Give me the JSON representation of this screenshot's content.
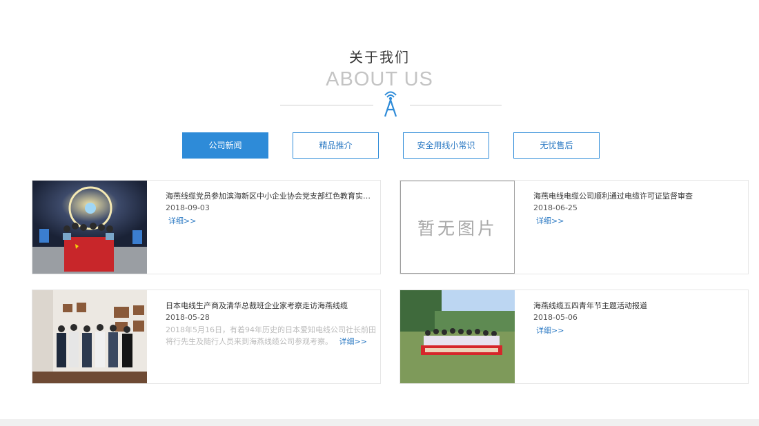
{
  "section": {
    "title_cn": "关于我们",
    "title_en": "ABOUT US",
    "divider_icon": "antenna-tower-icon"
  },
  "tabs": [
    {
      "label": "公司新闻",
      "active": true
    },
    {
      "label": "精品推介",
      "active": false
    },
    {
      "label": "安全用线小常识",
      "active": false
    },
    {
      "label": "无忧售后",
      "active": false
    }
  ],
  "news": [
    {
      "title": "海燕线缆党员参加滨海新区中小企业协会党支部红色教育实践活...",
      "date": "2018-09-03",
      "excerpt": "",
      "more": "详细>>",
      "image": "photo-party-members-with-flag"
    },
    {
      "title": "海燕电线电缆公司顺利通过电缆许可证监督审查",
      "date": "2018-06-25",
      "excerpt": "",
      "more": "详细>>",
      "image": "no-image-placeholder",
      "placeholder_text": "暂无图片"
    },
    {
      "title": "日本电线生产商及清华总裁班企业家考察走访海燕线缆",
      "date": "2018-05-28",
      "excerpt": "2018年5月16日，有着94年历史的日本爱知电线公司社长前田将行先生及随行人员来到海燕线缆公司参观考察。",
      "more": "详细>>",
      "image": "photo-visitors-group"
    },
    {
      "title": "海燕线缆五四青年节主题活动报道",
      "date": "2018-05-06",
      "excerpt": "",
      "more": "详细>>",
      "image": "photo-youth-day-group"
    }
  ],
  "colors": {
    "accent": "#2e8bd8",
    "link": "#2e7bc4",
    "border": "#e6e6e6"
  }
}
